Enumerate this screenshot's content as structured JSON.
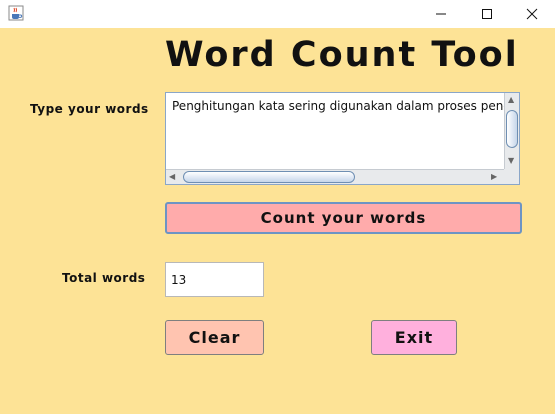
{
  "window": {
    "icon": "java-cup-icon",
    "minimize_icon": "minimize-icon",
    "maximize_icon": "maximize-icon",
    "close_icon": "close-icon"
  },
  "heading": "Word Count Tool",
  "labels": {
    "type_words": "Type your words",
    "total_words": "Total words"
  },
  "textarea": {
    "value": "Penghitungan kata sering digunakan dalam proses pengedit"
  },
  "buttons": {
    "count": "Count your words",
    "clear": "Clear",
    "exit": "Exit"
  },
  "total": {
    "value": "13"
  },
  "colors": {
    "background": "#fde396",
    "count_button": "#ffabab",
    "clear_button": "#ffc4b0",
    "exit_button": "#ffb0dd"
  }
}
